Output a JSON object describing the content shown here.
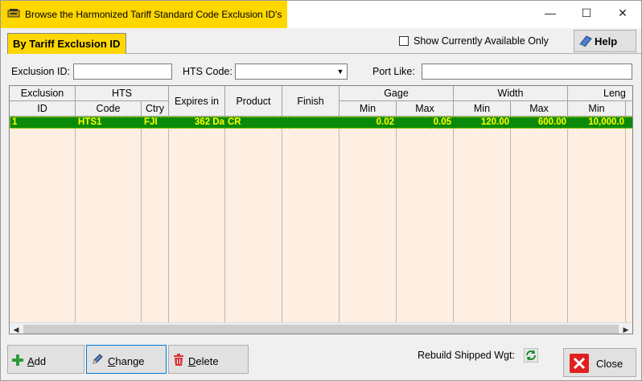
{
  "window": {
    "title": "Browse the Harmonized Tariff Standard Code Exclusion ID's",
    "controls": {
      "minimize": "—",
      "maximize": "☐",
      "close": "✕"
    }
  },
  "tab": {
    "label": "By Tariff Exclusion ID"
  },
  "toolbar": {
    "show_available_label": "Show Currently Available Only",
    "show_available_checked": false,
    "help_label": "Help"
  },
  "filters": {
    "exclusion_id_label": "Exclusion ID:",
    "exclusion_id_value": "",
    "hts_code_label": "HTS Code:",
    "hts_code_value": "",
    "port_like_label": "Port Like:",
    "port_like_value": ""
  },
  "grid": {
    "group_headers": {
      "exclusion": "Exclusion",
      "hts": "HTS",
      "expires": "Expires in",
      "product": "Product",
      "finish": "Finish",
      "gage": "Gage",
      "width": "Width",
      "length": "Leng"
    },
    "sub_headers": {
      "id": "ID",
      "code": "Code",
      "ctry": "Ctry",
      "gage_min": "Min",
      "gage_max": "Max",
      "width_min": "Min",
      "width_max": "Max",
      "length_min": "Min"
    },
    "rows": [
      {
        "id": "1",
        "code": "HTS1",
        "ctry": "FJI",
        "expires": "362 Da",
        "product": "CR",
        "finish": "",
        "gage_min": "0.02",
        "gage_max": "0.05",
        "width_min": "120.00",
        "width_max": "600.00",
        "length_min": "10,000.0"
      }
    ]
  },
  "footer": {
    "add_label": "Add",
    "change_label": "Change",
    "delete_label": "Delete",
    "rebuild_label": "Rebuild Shipped Wgt:",
    "close_label": "Close"
  },
  "colors": {
    "highlight": "#ffd700",
    "grid_background": "#ffeee2",
    "selected_row": "#0a8a0a",
    "selected_text": "#ffff00"
  }
}
